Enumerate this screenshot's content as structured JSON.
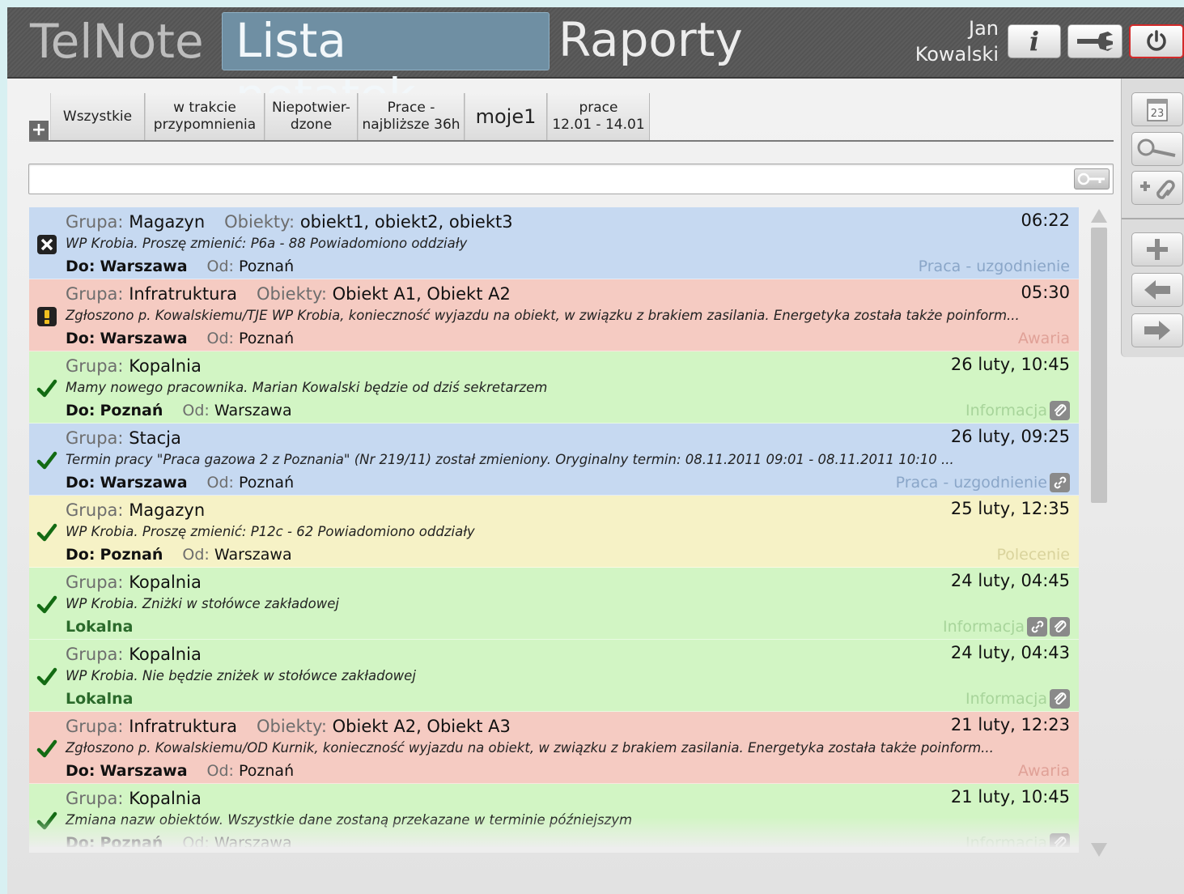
{
  "header": {
    "brand": "TelNote",
    "nav": {
      "notes_label": "Lista notatek",
      "reports_label": "Raporty"
    },
    "user": {
      "first": "Jan",
      "last": "Kowalski"
    },
    "info_label": "i"
  },
  "filter_tabs": [
    {
      "label": "Wszystkie"
    },
    {
      "label": "w trakcie\nprzypomnienia"
    },
    {
      "label": "Niepotwier-\ndzone"
    },
    {
      "label": "Prace -\nnajbliższe 36h"
    },
    {
      "label": "moje1"
    },
    {
      "label": "prace\n12.01 - 14.01"
    }
  ],
  "search": {
    "value": "",
    "placeholder": ""
  },
  "labels": {
    "group": "Grupa:",
    "objects": "Obiekty:",
    "to": "Do:",
    "from": "Od:"
  },
  "notes": [
    {
      "group": "Magazyn",
      "objects": "obiekt1, obiekt2, obiekt3",
      "time": "06:22",
      "text": "WP Krobia.  Proszę zmienić: P6a - 88  Powiadomiono oddziały",
      "to": "Warszawa",
      "from": "Poznań",
      "local": "",
      "type": "Praca - uzgodnienie",
      "color": "blue",
      "status": "rejected"
    },
    {
      "group": "Infratruktura",
      "objects": "Obiekt A1, Obiekt A2",
      "time": "05:30",
      "text": "Zgłoszono p. Kowalskiemu/TJE WP Krobia, konieczność wyjazdu na obiekt, w związku z brakiem zasilania. Energetyka została także poinform...",
      "to": "Warszawa",
      "from": "Poznań",
      "local": "",
      "type": "Awaria",
      "color": "red",
      "status": "warning"
    },
    {
      "group": "Kopalnia",
      "objects": "",
      "time": "26 luty, 10:45",
      "text": "Mamy nowego pracownika. Marian Kowalski będzie od dziś sekretarzem",
      "to": "Poznań",
      "from": "Warszawa",
      "local": "",
      "type": "Informacja",
      "color": "green",
      "status": "confirmed"
    },
    {
      "group": "Stacja",
      "objects": "",
      "time": "26 luty, 09:25",
      "text": "Termin pracy \"Praca gazowa 2 z Poznania\" (Nr 219/11) został zmieniony. Oryginalny termin: 08.11.2011 09:01 - 08.11.2011 10:10 ...",
      "to": "Warszawa",
      "from": "Poznań",
      "local": "",
      "type": "Praca - uzgodnienie",
      "color": "blue",
      "status": "confirmed"
    },
    {
      "group": "Magazyn",
      "objects": "",
      "time": "25 luty, 12:35",
      "text": "WP Krobia.  Proszę zmienić: P12c - 62  Powiadomiono oddziały",
      "to": "Poznań",
      "from": "Warszawa",
      "local": "",
      "type": "Polecenie",
      "color": "yellow",
      "status": "confirmed"
    },
    {
      "group": "Kopalnia",
      "objects": "",
      "time": "24 luty, 04:45",
      "text": "WP Krobia.  Zniżki w stołówce zakładowej",
      "to": "",
      "from": "",
      "local": "Lokalna",
      "type": "Informacja",
      "color": "green",
      "status": "confirmed"
    },
    {
      "group": "Kopalnia",
      "objects": "",
      "time": "24 luty, 04:43",
      "text": "WP Krobia.  Nie będzie zniżek w stołówce zakładowej",
      "to": "",
      "from": "",
      "local": "Lokalna",
      "type": "Informacja",
      "color": "green",
      "status": "confirmed"
    },
    {
      "group": "Infratruktura",
      "objects": "Obiekt A2, Obiekt A3",
      "time": "21 luty, 12:23",
      "text": "Zgłoszono p. Kowalskiemu/OD Kurnik, konieczność wyjazdu na obiekt, w związku z brakiem zasilania. Energetyka została także poinform...",
      "to": "Warszawa",
      "from": "Poznań",
      "local": "",
      "type": "Awaria",
      "color": "red",
      "status": "confirmed"
    },
    {
      "group": "Kopalnia",
      "objects": "",
      "time": "21 luty, 10:45",
      "text": "Zmiana nazw obiektów. Wszystkie dane zostaną przekazane w terminie późniejszym",
      "to": "Poznań",
      "from": "Warszawa",
      "local": "",
      "type": "Informacja",
      "color": "green",
      "status": "confirmed"
    }
  ],
  "colors": {
    "blue": "#c6d9f1",
    "red": "#f5cbc2",
    "green": "#d2f5c4",
    "yellow": "#f6f2c6",
    "active_tab": "#6f8fa3",
    "power_border": "#d32a2a"
  },
  "icons": {
    "info": "info-icon",
    "settings": "wrench-icon",
    "power": "power-icon",
    "calendar": "calendar-icon",
    "search": "key-search-icon",
    "link_add": "add-link-icon",
    "add": "plus-icon",
    "back": "arrow-left-icon",
    "forward": "arrow-right-icon",
    "calendar_day": "23"
  }
}
